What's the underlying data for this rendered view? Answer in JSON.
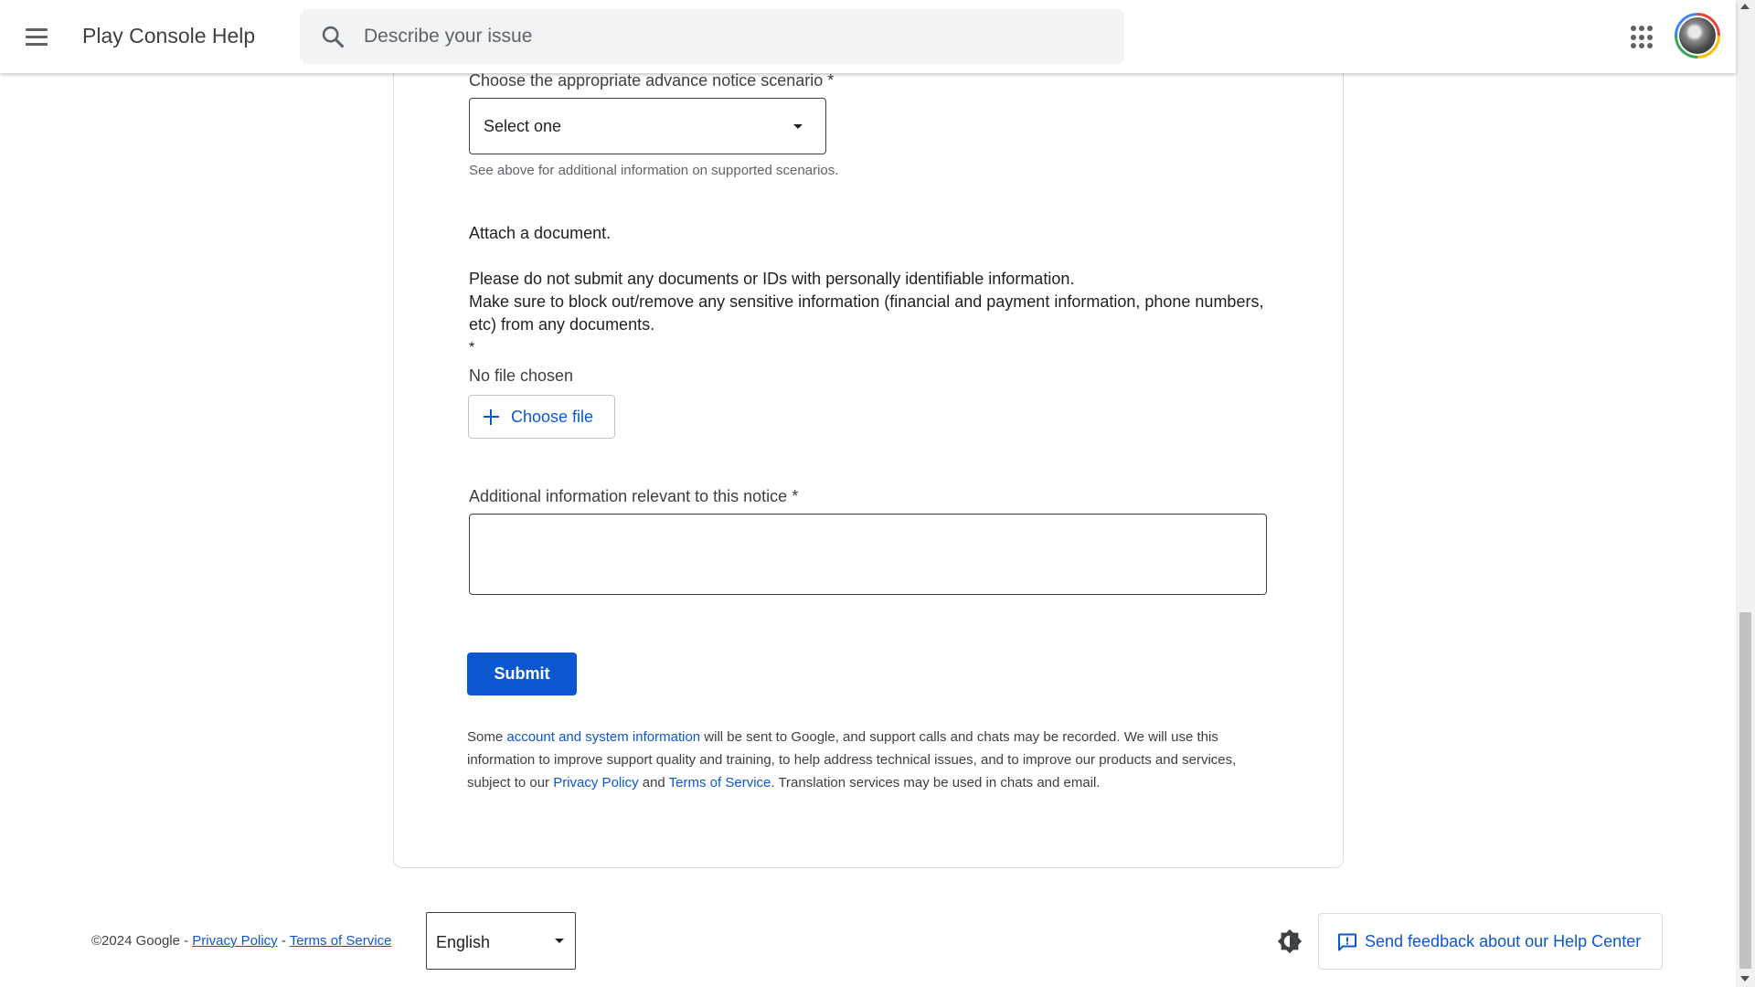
{
  "header": {
    "title": "Play Console Help",
    "search_placeholder": "Describe your issue"
  },
  "form": {
    "scenario_label": "Choose the appropriate advance notice scenario *",
    "scenario_selected": "Select one",
    "scenario_hint": "See above for additional information on supported scenarios.",
    "attach_heading": "Attach a document.",
    "attach_line1": "Please do not submit any documents or IDs with personally identifiable information.",
    "attach_line2": "Make sure to block out/remove any sensitive information (financial and payment information, phone numbers, etc) from any documents.",
    "attach_required": "*",
    "no_file": "No file chosen",
    "choose_file": "Choose file",
    "additional_label": "Additional information relevant to this notice *",
    "additional_value": "",
    "submit": "Submit"
  },
  "disclaimer": {
    "part1": "Some ",
    "link1": "account and system information",
    "part2": " will be sent to Google, and support calls and chats may be recorded. We will use this information to improve support quality and training, to help address technical issues, and to improve our products and services, subject to our ",
    "link2": "Privacy Policy",
    "part3": " and ",
    "link3": "Terms of Service",
    "part4": ". Translation services may be used in chats and email."
  },
  "footer": {
    "copyright": "©2024 Google - ",
    "privacy": "Privacy Policy",
    "separator": " - ",
    "terms": "Terms of Service",
    "language": "English",
    "feedback": "Send feedback about our Help Center"
  },
  "colors": {
    "accent": "#0b57d0",
    "text": "#202124",
    "border": "#dadce0"
  },
  "icons": [
    "menu-icon",
    "search-icon",
    "apps-icon",
    "avatar",
    "dropdown-caret-icon",
    "plus-icon",
    "theme-toggle-icon",
    "feedback-icon"
  ]
}
